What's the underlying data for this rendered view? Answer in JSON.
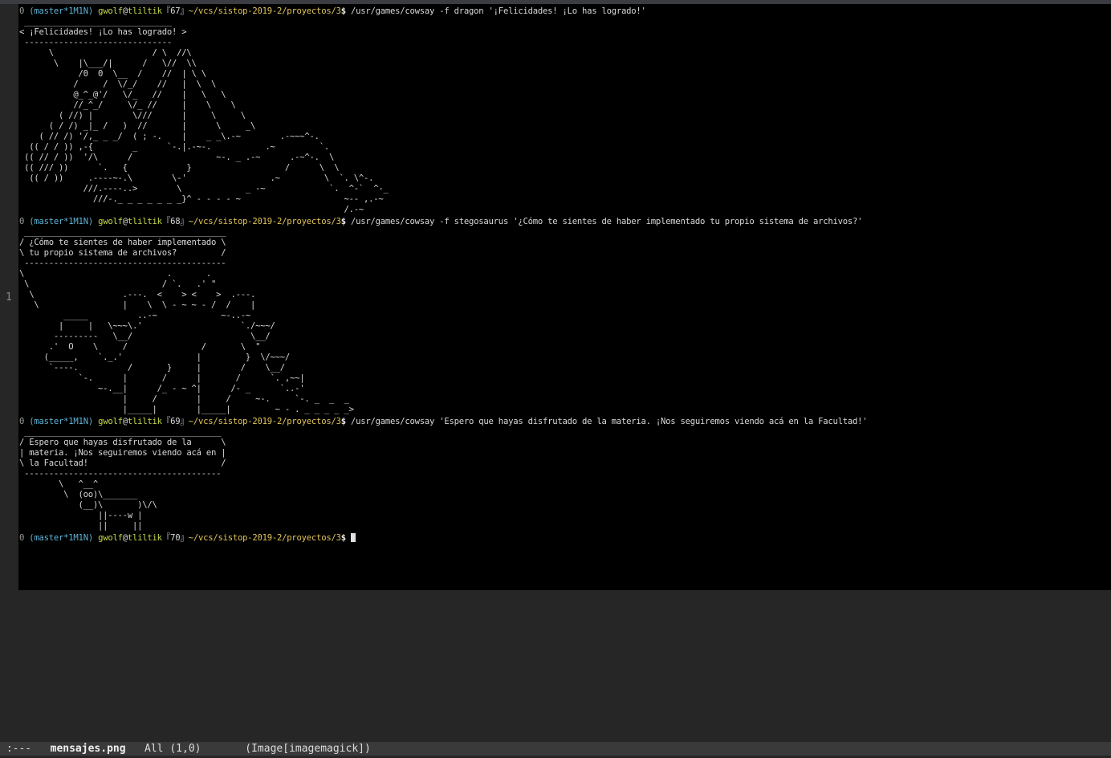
{
  "gutter": {
    "line_number": "1"
  },
  "prompt": {
    "status": "0",
    "branch": "(master*1M1N)",
    "user": "gwolf",
    "at": "@",
    "host": "tliltik",
    "path": "~/vcs/sistop-2019-2/proyectos/3",
    "dollar": "$"
  },
  "blocks": [
    {
      "prompt_num": "『67』",
      "command": " /usr/games/cowsay -f dragon '¡Felicidades! ¡Lo has logrado!'",
      "output": [
        " ______________________________",
        "< ¡Felicidades! ¡Lo has logrado! >",
        " ------------------------------",
        "      \\                    / \\  //\\",
        "       \\    |\\___/|      /   \\//  \\\\",
        "            /0  0  \\__  /    //  | \\ \\",
        "           /     /  \\/_/    //   |  \\  \\",
        "           @_^_@'/   \\/_   //    |   \\   \\",
        "           //_^_/     \\/_ //     |    \\    \\",
        "        ( //) |        \\///      |     \\     \\",
        "      ( / /) _|_ /   )  //       |      \\     _\\",
        "    ( // /) '/,_ _ _/  ( ; -.    |    _ _\\.-~        .-~~~^-.",
        "  (( / / )) ,-{        _      `-.|.-~-.           .~         `.",
        " (( // / ))  '/\\      /                 ~-. _ .-~      .-~^-.  \\",
        " (( /// ))      `.   {            }                   /      \\  \\",
        "  (( / ))     .----~-.\\        \\-'                 .~         \\  `. \\^-.",
        "             ///.----..>        \\             _ -~             `.  ^-`  ^-_",
        "               ///-._ _ _ _ _ _ _}^ - - - - ~                     ~-- ,.-~",
        "                                                                  /.-~"
      ]
    },
    {
      "prompt_num": "『68』",
      "command": " /usr/games/cowsay -f stegosaurus '¿Cómo te sientes de haber implementado tu propio sistema de archivos?'",
      "output": [
        " _________________________________________",
        "/ ¿Cómo te sientes de haber implementado \\",
        "\\ tu propio sistema de archivos?         /",
        " -----------------------------------------",
        "\\                             .       .",
        " \\                           / `.   .' \"",
        "  \\                  .---.  <    > <    >  .---.",
        "   \\                 |    \\  \\ - ~ ~ - /  /    |",
        "         _____          ..-~             ~-..-~",
        "        |     |   \\~~~\\.'                    `./~~~/",
        "       ---------   \\__/                        \\__/",
        "      .'  O    \\     /               /       \\  \"",
        "     (_____,    `._.'               |         }  \\/~~~/",
        "      `----.          /       }     |        /    \\__/",
        "            `-.      |       /      |       /      `. ,~~|",
        "                ~-.__|      /_ - ~ ^|      /- _      `..-'",
        "                     |     /        |     /     ~-.     `-. _  _  _",
        "                     |_____|        |_____|         ~ - . _ _ _ _ _>"
      ]
    },
    {
      "prompt_num": "『69』",
      "command": " /usr/games/cowsay 'Espero que hayas disfrutado de la materia. ¡Nos seguiremos viendo acá en la Facultad!'",
      "output": [
        " ________________________________________",
        "/ Espero que hayas disfrutado de la      \\",
        "| materia. ¡Nos seguiremos viendo acá en |",
        "\\ la Facultad!                           /",
        " ----------------------------------------",
        "        \\   ^__^",
        "         \\  (oo)\\_______",
        "            (__)\\       )\\/\\",
        "                ||----w |",
        "                ||     ||"
      ]
    }
  ],
  "last_prompt_num": "『70』",
  "modeline": {
    "state": " :---",
    "buffer_name": "mensajes.png",
    "position": "All (1,0)",
    "mode": "(Image[imagemagick])"
  }
}
